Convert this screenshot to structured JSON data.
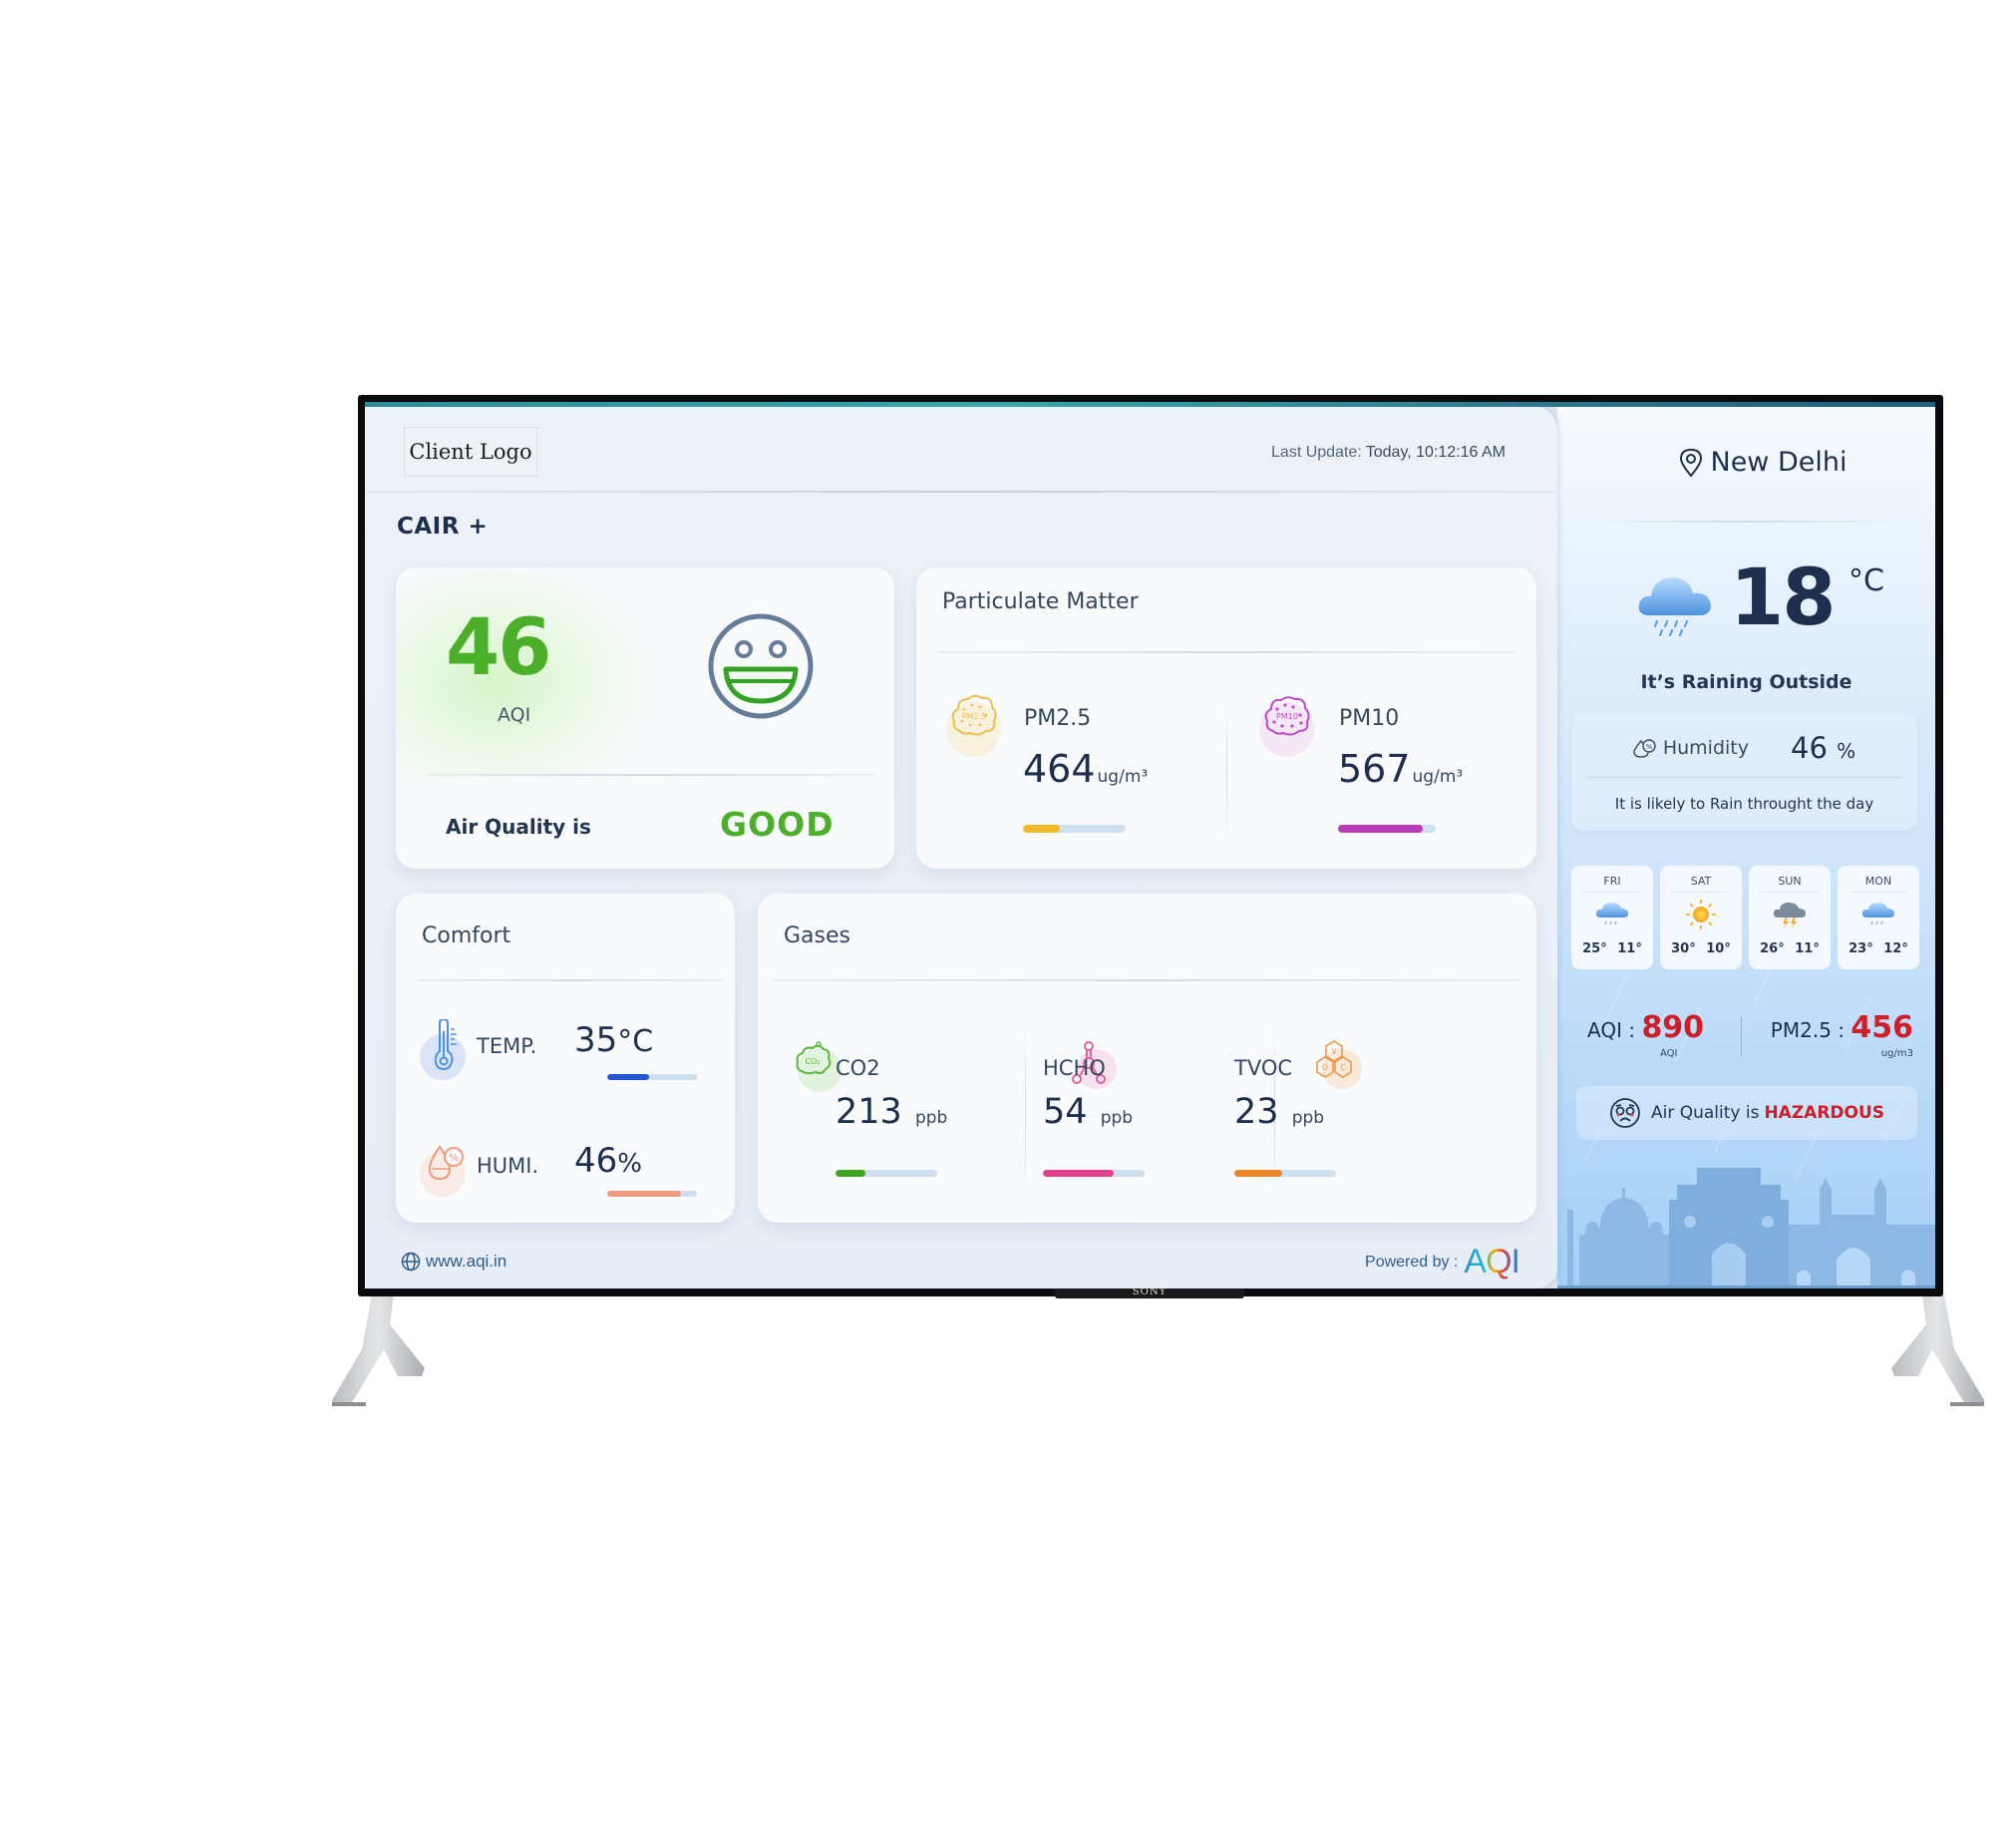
{
  "device": {
    "brand": "SONY"
  },
  "header": {
    "client_logo": "Client Logo",
    "last_update_label": "Last Update:",
    "last_update_value": "Today, 10:12:16 AM",
    "title": "CAIR +"
  },
  "aqi_card": {
    "value": "46",
    "label": "AQI",
    "status_prefix": "Air Quality is",
    "status": "GOOD",
    "status_color": "#4caf2a",
    "icon": "smiley-happy-icon"
  },
  "particulate": {
    "title": "Particulate Matter",
    "items": [
      {
        "name": "PM2.5",
        "value": "464",
        "unit": "ug/m³",
        "bar_fraction": 0.36,
        "color": "#f0bc2a",
        "icon": "pm25-cloud-icon"
      },
      {
        "name": "PM10",
        "value": "567",
        "unit": "ug/m³",
        "bar_fraction": 0.87,
        "color": "#b73cb9",
        "icon": "pm10-cloud-icon"
      }
    ]
  },
  "comfort": {
    "title": "Comfort",
    "items": [
      {
        "name": "TEMP.",
        "value": "35",
        "unit": "°C",
        "bar_fraction": 0.47,
        "color": "#2457d6",
        "icon": "thermometer-icon"
      },
      {
        "name": "HUMI.",
        "value": "46",
        "unit": "%",
        "bar_fraction": 0.82,
        "color": "#f19a80",
        "icon": "humidity-drops-icon"
      }
    ]
  },
  "gases": {
    "title": "Gases",
    "items": [
      {
        "name": "CO2",
        "value": "213",
        "unit": "ppb",
        "bar_fraction": 0.29,
        "color": "#3fa521",
        "icon": "co2-cloud-icon"
      },
      {
        "name": "HCHO",
        "value": "54",
        "unit": "ppb",
        "bar_fraction": 0.7,
        "color": "#e2408c",
        "icon": "hcho-molecule-icon"
      },
      {
        "name": "TVOC",
        "value": "23",
        "unit": "ppb",
        "bar_fraction": 0.47,
        "color": "#ec862a",
        "icon": "tvoc-molecule-icon"
      }
    ]
  },
  "footer": {
    "website": "www.aqi.in",
    "powered_by": "Powered by :",
    "powered_logo": "AQI"
  },
  "weather": {
    "city": "New Delhi",
    "temperature": "18",
    "temperature_unit": "°C",
    "condition": "It’s Raining Outside",
    "humidity_label": "Humidity",
    "humidity_value": "46",
    "humidity_unit": "%",
    "note": "It is likely to Rain throught the day",
    "forecast": [
      {
        "day": "FRI",
        "icon": "rain-cloud-icon",
        "high": "25°",
        "low": "11°"
      },
      {
        "day": "SAT",
        "icon": "sun-icon",
        "high": "30°",
        "low": "10°"
      },
      {
        "day": "SUN",
        "icon": "thunderstorm-icon",
        "high": "26°",
        "low": "11°"
      },
      {
        "day": "MON",
        "icon": "rain-cloud-icon",
        "high": "23°",
        "low": "12°"
      }
    ],
    "outdoor": {
      "aqi_label": "AQI :",
      "aqi_value": "890",
      "aqi_unit": "AQI",
      "pm_label": "PM2.5 :",
      "pm_value": "456",
      "pm_unit": "ug/m3",
      "status_prefix": "Air Quality is",
      "status": "HAZARDOUS",
      "status_color": "#cc1f2a"
    }
  }
}
